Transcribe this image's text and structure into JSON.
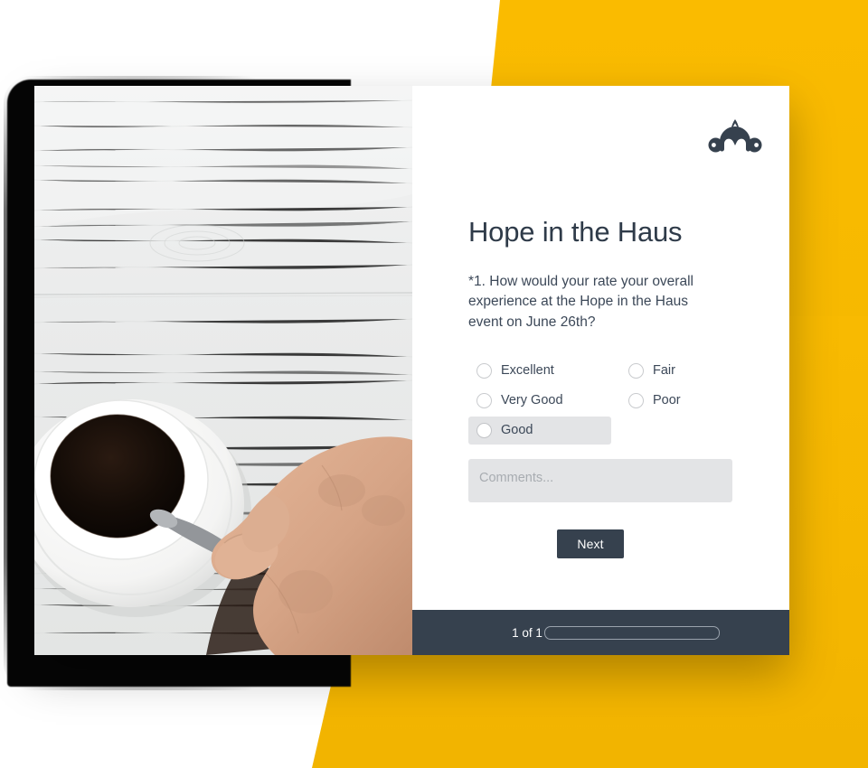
{
  "page": {
    "accent_yellow": "#f9bc05",
    "dark_slate": "#36414e"
  },
  "brand": {
    "logo_name": "surveymonkey-logo"
  },
  "survey": {
    "title": "Hope in the Haus",
    "question": "*1. How would your rate your overall experience at the Hope in the Haus event on June 26th?",
    "options": [
      {
        "label": "Excellent",
        "selected": false,
        "highlighted": false
      },
      {
        "label": "Fair",
        "selected": false,
        "highlighted": false
      },
      {
        "label": "Very Good",
        "selected": false,
        "highlighted": false
      },
      {
        "label": "Poor",
        "selected": false,
        "highlighted": false
      },
      {
        "label": "Good",
        "selected": false,
        "highlighted": true
      }
    ],
    "comments": {
      "value": "",
      "placeholder": "Comments..."
    },
    "next_label": "Next"
  },
  "footer": {
    "progress_label": "1 of 1",
    "progress_percent": 0
  },
  "photo": {
    "alt": "hand-holding-coffee-cup-on-white-wood-table"
  }
}
